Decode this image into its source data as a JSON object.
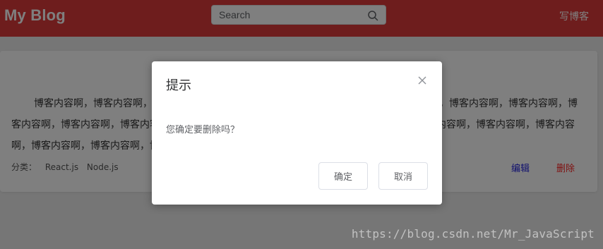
{
  "header": {
    "brand": "My Blog",
    "search_placeholder": "Search",
    "write_blog": "写博客"
  },
  "post": {
    "content": "博客内容啊，博客内容啊，博客内容啊，博客内容啊，博客内容啊，博客内容啊，博客内容啊，博客内容啊，博客内容啊，博客内容啊，博客内容啊，博客内容啊，博客内容啊，博客内容啊，博客内容啊，博客内容啊，博客内容啊，博客内容啊，博客内容啊，博客内容啊，博客内容啊，博客内容啊，博客内容啊。",
    "category_label": "分类：",
    "tags": [
      "React.js",
      "Node.js"
    ],
    "edit": "编辑",
    "delete": "删除"
  },
  "dialog": {
    "title": "提示",
    "message": "您确定要删除吗？",
    "confirm": "确定",
    "cancel": "取消"
  },
  "watermark": "https://blog.csdn.net/Mr_JavaScript",
  "colors": {
    "header_bg": "#dd3b3b",
    "edit_link": "#2222dd",
    "delete_link": "#ff2222"
  },
  "icons": [
    "search-icon",
    "close-icon"
  ]
}
